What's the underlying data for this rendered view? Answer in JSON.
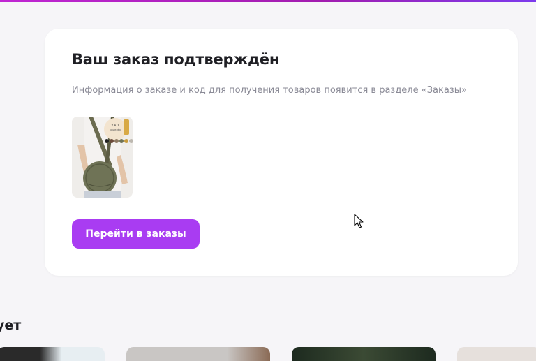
{
  "order_card": {
    "title": "Ваш заказ подтверждён",
    "subtitle": "Информация о заказе и код для получения товаров появится в разделе «Заказы»",
    "product_image": "crossbody-round-bag-olive",
    "cta_label": "Перейти в заказы"
  },
  "recommendations": {
    "heading_fragment": "ует",
    "items": [
      {
        "image": "product-photo-1"
      },
      {
        "image": "product-photo-2"
      },
      {
        "image": "product-photo-3"
      },
      {
        "image": "product-photo-4"
      }
    ]
  },
  "colors": {
    "accent": "#a93cf2",
    "top_bar": "#c026d3",
    "page_bg": "#f6f5f8",
    "card_bg": "#ffffff"
  }
}
